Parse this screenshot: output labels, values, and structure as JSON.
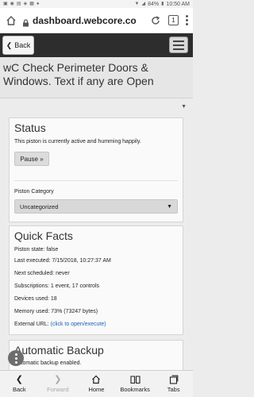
{
  "status_bar": {
    "time": "10:50 AM",
    "battery": "84%"
  },
  "browser": {
    "url": "dashboard.webcore.co",
    "tab_count": "1"
  },
  "header": {
    "back_label": "Back"
  },
  "page": {
    "title": "wC Check Perimeter Doors & Windows. Text if any are Open"
  },
  "status_panel": {
    "title": "Status",
    "text": "This piston is currently active and humming happily.",
    "pause_label": "Pause »",
    "category_label": "Piston Category",
    "category_value": "Uncategorized"
  },
  "quick_facts": {
    "title": "Quick Facts",
    "state": "Piston state: false",
    "last_executed": "Last executed: 7/15/2018, 10:27:37 AM",
    "next_scheduled": "Next scheduled: never",
    "subscriptions": "Subscriptions: 1 event, 17 controls",
    "devices": "Devices used: 18",
    "memory": "Memory used: 73% (73247 bytes)",
    "external_label": "External URL: ",
    "external_link": "(click to open/execute)"
  },
  "backup_panel": {
    "title": "Automatic Backup",
    "text": "Automatic backup enabled."
  },
  "bottom_nav": {
    "back": "Back",
    "forward": "Forward",
    "home": "Home",
    "bookmarks": "Bookmarks",
    "tabs": "Tabs"
  }
}
